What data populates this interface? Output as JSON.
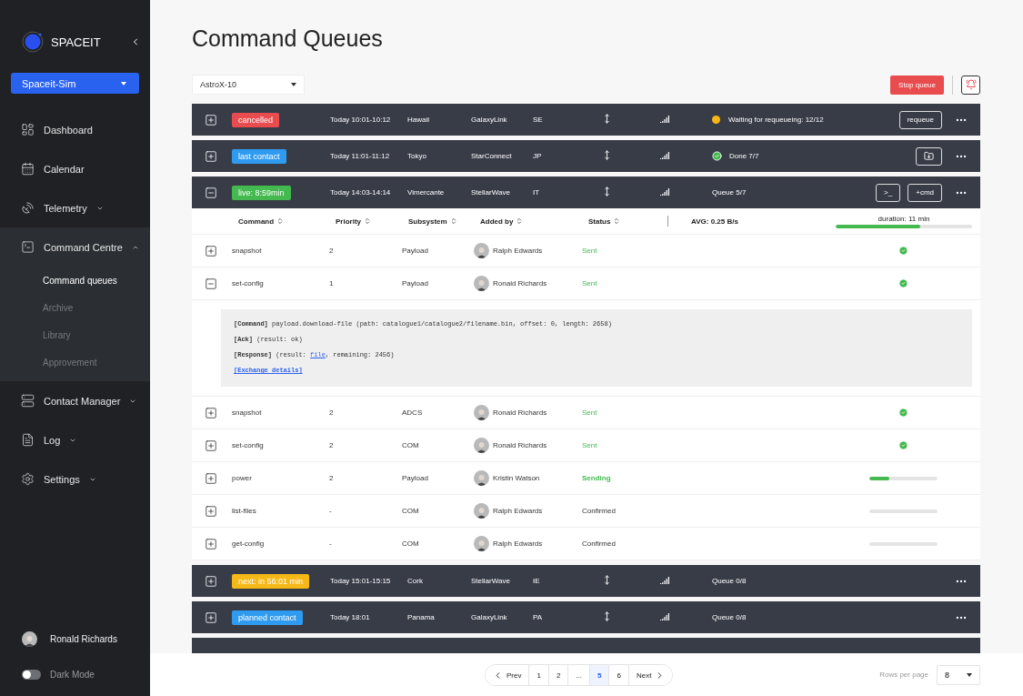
{
  "brand": {
    "name": "SPACEIT"
  },
  "workspace": {
    "label": "Spaceit-Sim"
  },
  "nav": [
    {
      "label": "Dashboard"
    },
    {
      "label": "Calendar"
    },
    {
      "label": "Telemetry",
      "expanded": false
    },
    {
      "label": "Command Centre",
      "expanded": true,
      "children": [
        {
          "label": "Command queues",
          "selected": true
        },
        {
          "label": "Archive",
          "selected": false
        },
        {
          "label": "Library",
          "selected": false
        },
        {
          "label": "Approvement",
          "selected": false
        }
      ]
    },
    {
      "label": "Contact Manager",
      "expanded": false
    },
    {
      "label": "Log",
      "expanded": false
    },
    {
      "label": "Settings",
      "expanded": false
    }
  ],
  "user": {
    "name": "Ronald Richards"
  },
  "dark_mode": {
    "label": "Dark Mode",
    "on": false
  },
  "page_title": "Command Queues",
  "satellite_select": {
    "value": "AstroX-10"
  },
  "stop_button": "Stop queue",
  "queues": [
    {
      "expanded": false,
      "badge": "cancelled",
      "color": "#e84c4f",
      "time": "Today 10:01-10:12",
      "place": "Hawaii",
      "network": "GalaxyLink",
      "country": "SE",
      "status": {
        "kind": "warning",
        "text": "Waiting for requeueing: 12/12"
      },
      "actions": [
        {
          "kind": "text",
          "label": "requeue"
        }
      ]
    },
    {
      "expanded": false,
      "badge": "last contact",
      "color": "#2f9bf0",
      "time": "Today 11:01-11:12",
      "place": "Tokyo",
      "network": "StarConnect",
      "country": "JP",
      "status": {
        "kind": "done",
        "text": "Done 7/7"
      },
      "actions": [
        {
          "kind": "download"
        }
      ]
    },
    {
      "expanded": true,
      "badge": "live: 8:59min",
      "color": "#43b94f",
      "time": "Today 14:03-14:14",
      "place": "Vimercante",
      "network": "StellarWave",
      "country": "IT",
      "status": {
        "kind": "plain",
        "text": "Queue 5/7"
      },
      "actions": [
        {
          "kind": "text",
          "label": ">_"
        },
        {
          "kind": "text",
          "label": "+cmd"
        }
      ],
      "table": {
        "columns": [
          "Command",
          "Priority",
          "Subsystem",
          "Added by",
          "Status"
        ],
        "avg": "AVG: 0.25 B/s",
        "duration": {
          "label": "duration: 11 min",
          "level": 0.62
        },
        "rows": [
          {
            "kind": "sent",
            "command": "snapshot",
            "priority": "2",
            "subsystem": "Payload",
            "added_by": "Ralph Edwards",
            "status": "Sent",
            "expanded": false
          },
          {
            "kind": "sent",
            "command": "set-config",
            "priority": "1",
            "subsystem": "Payload",
            "added_by": "Ronald Richards",
            "status": "Sent",
            "expanded": true,
            "details": {
              "lines": [
                {
                  "label": "[Command]",
                  "text": "payload.download-file (path: catalogue1/catalogue2/filename.bin, offset: 0, length: 2658)"
                },
                {
                  "label": "[Ack]",
                  "text": "(result: ok)"
                },
                {
                  "label": "[Response]",
                  "text": "(result: ",
                  "link": "file",
                  "after": ", remaining: 2456)"
                }
              ],
              "link": "[Exchange details]"
            }
          },
          {
            "kind": "sent",
            "command": "snapshot",
            "priority": "2",
            "subsystem": "ADCS",
            "added_by": "Ronald Richards",
            "status": "Sent",
            "expanded": false
          },
          {
            "kind": "sent",
            "command": "set-config",
            "priority": "2",
            "subsystem": "COM",
            "added_by": "Ronald Richards",
            "status": "Sent",
            "expanded": false
          },
          {
            "kind": "sending",
            "command": "power",
            "priority": "2",
            "subsystem": "Payload",
            "added_by": "Kristin Watson",
            "status": "Sending",
            "level": 0.3,
            "expanded": false
          },
          {
            "kind": "confirmed",
            "command": "list-files",
            "priority": "-",
            "subsystem": "COM",
            "added_by": "Ralph Edwards",
            "status": "Confirmed",
            "expanded": false
          },
          {
            "kind": "confirmed",
            "command": "get-config",
            "priority": "-",
            "subsystem": "COM",
            "added_by": "Ralph Edwards",
            "status": "Confirmed",
            "expanded": false
          }
        ]
      }
    },
    {
      "expanded": false,
      "badge": "next: in 56:01 min",
      "color": "#f6b817",
      "time": "Today 15:01-15:15",
      "place": "Cork",
      "network": "StellarWave",
      "country": "IE",
      "status": {
        "kind": "plain",
        "text": "Queue 0/8"
      }
    },
    {
      "expanded": false,
      "badge": "planned contact",
      "color": "#2f9bf0",
      "time": "Today 18:01",
      "place": "Panama",
      "network": "GalaxyLink",
      "country": "PA",
      "status": {
        "kind": "plain",
        "text": "Queue 0/8"
      }
    }
  ],
  "pagination": {
    "prev": "Prev",
    "next": "Next",
    "pages": [
      {
        "kind": "page",
        "label": "1",
        "selected": false
      },
      {
        "kind": "page",
        "label": "2",
        "selected": false
      },
      {
        "kind": "gap",
        "label": "..."
      },
      {
        "kind": "page",
        "label": "5",
        "selected": true
      },
      {
        "kind": "page",
        "label": "6",
        "selected": false
      }
    ]
  },
  "rows_per_page": {
    "label": "Rows per page",
    "value": "8"
  }
}
